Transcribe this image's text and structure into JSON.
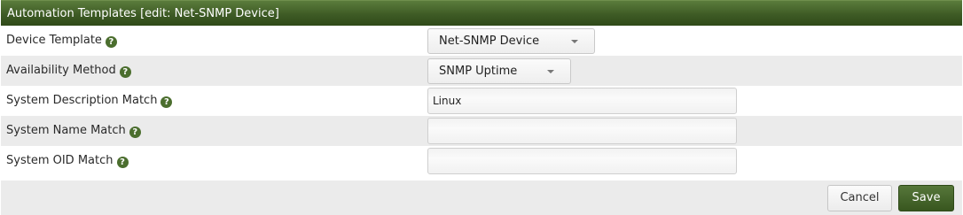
{
  "header": {
    "title": "Automation Templates [edit: Net-SNMP Device]"
  },
  "form": {
    "rows": [
      {
        "label": "Device Template",
        "type": "select",
        "value": "Net-SNMP Device"
      },
      {
        "label": "Availability Method",
        "type": "select",
        "value": "SNMP Uptime"
      },
      {
        "label": "System Description Match",
        "type": "text",
        "value": "Linux",
        "placeholder": ""
      },
      {
        "label": "System Name Match",
        "type": "text",
        "value": "",
        "placeholder": ""
      },
      {
        "label": "System OID Match",
        "type": "text",
        "value": "",
        "placeholder": ""
      }
    ],
    "help_icon": "question-circle-icon",
    "help_glyph": "?"
  },
  "footer": {
    "cancel_label": "Cancel",
    "save_label": "Save"
  },
  "colors": {
    "header_bg": "#3e5b25",
    "accent": "#4b6e2e",
    "row_alt_bg": "#ebebeb"
  }
}
